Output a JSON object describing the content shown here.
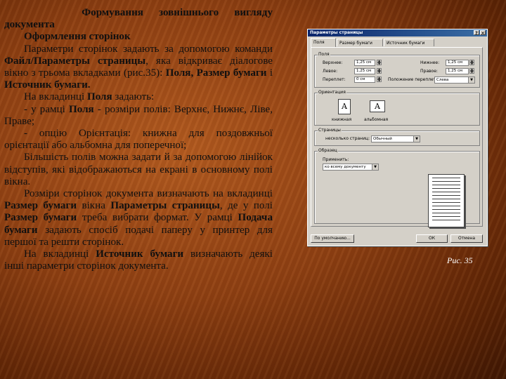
{
  "text": {
    "title_line1_w1": "Формування",
    "title_line1_w2": "зовнішнього",
    "title_line1_w3": "вигляду",
    "title_line2": "документа",
    "subtitle": "Оформлення сторінок",
    "p1_a": "Параметри сторінок задають за допомогою команди ",
    "p1_b": "Файл/Параметры страницы",
    "p1_c": ", яка відкриває діалогове вікно з трьома вкладками (рис.35): ",
    "p1_d": "Поля",
    "p1_e": ", ",
    "p1_f": "Размер бумаги",
    "p1_g": " і ",
    "p1_h": "Источник бумаги",
    "p1_i": ".",
    "p2_a": "На вкладинці ",
    "p2_b": "Поля",
    "p2_c": " задають:",
    "p3_a": "- у рамці ",
    "p3_b": "Поля",
    "p3_c": " - розміри полів: Верхнє, Нижнє, Ліве, Праве;",
    "p4": "- опцію Орієнтація: книжна для поздовжньої орієнтації або альбомна для поперечної;",
    "p5": "Більшість полів можна задати й за допомогою лінійок відступів, які відображаються на екрані в основному полі вікна.",
    "p6_a": "Розміри сторінок документа визначають на вкладинці ",
    "p6_b": "Размер бумаги",
    "p6_c": " вікна ",
    "p6_d": "Параметры страницы",
    "p6_e": ", де у полі ",
    "p6_f": "Размер бумаги",
    "p6_g": " треба вибрати формат. У рамці ",
    "p6_h": "Подача бумаги",
    "p6_i": " задають спосіб подачі паперу у принтер для першої та решти сторінок.",
    "p7_a": "На вкладинці ",
    "p7_b": "Источник бумаги",
    "p7_c": " визначають деякі інші параметри сторінок документа."
  },
  "dialog": {
    "title": "Параметры страницы",
    "help_glyph": "?",
    "close_glyph": "×",
    "tabs": [
      "Поля",
      "Размер бумаги",
      "Источник бумаги"
    ],
    "margins_group": "Поля",
    "top_label": "Верхнее:",
    "top_value": "1,25 см",
    "bottom_label": "Нижнее:",
    "bottom_value": "1,25 см",
    "left_label": "Левое:",
    "left_value": "1,25 см",
    "right_label": "Правое:",
    "right_value": "1,25 см",
    "gutter_label": "Переплет:",
    "gutter_value": "0 см",
    "gutter_pos_label": "Положение переплета:",
    "gutter_pos_value": "Слева",
    "orientation_group": "Ориентация",
    "portrait": "книжная",
    "landscape": "альбомная",
    "portrait_glyph": "A",
    "landscape_glyph": "A",
    "pages_group": "Страницы",
    "multiple_pages_label": "несколько страниц:",
    "multiple_pages_value": "Обычный",
    "preview_group": "Образец",
    "apply_label": "Применить:",
    "apply_value": "ко всему документу",
    "default_button": "По умолчанию...",
    "ok_button": "ОК",
    "cancel_button": "Отмена",
    "spin_up": "▲",
    "spin_down": "▼",
    "dropdown_glyph": "▼"
  },
  "caption": "Рис. 35",
  "colors": {
    "background": "#8e3f12",
    "caption": "#ffffff",
    "dialog_face": "#d4d0c8",
    "titlebar": "#0a246a"
  }
}
